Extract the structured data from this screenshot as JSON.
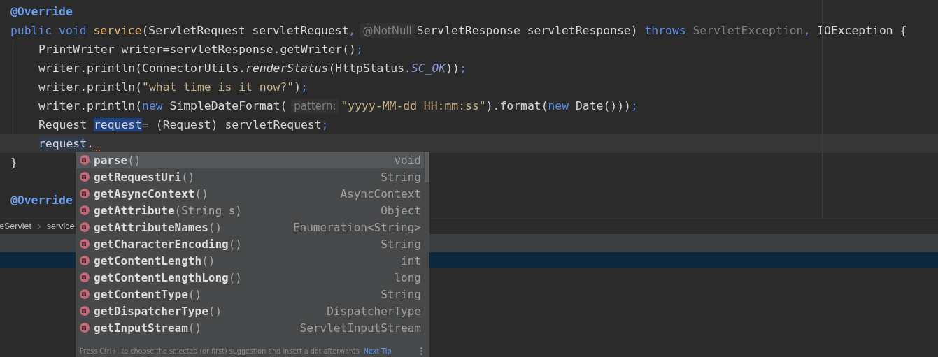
{
  "editor": {
    "lines": [
      {
        "current": false,
        "segments": [
          {
            "kind": "code",
            "tokens": [
              {
                "t": "@Override",
                "kind": "annotation"
              }
            ]
          }
        ]
      },
      {
        "current": false,
        "segments": [
          {
            "kind": "code",
            "tokens": [
              {
                "t": "public void ",
                "kind": "keyword"
              },
              {
                "t": "service",
                "kind": "method"
              },
              {
                "t": "(ServletRequest servletRequest",
                "kind": "plain"
              },
              {
                "t": ",",
                "kind": "punct"
              }
            ]
          },
          {
            "kind": "hint",
            "text": "@NotNull"
          },
          {
            "kind": "code",
            "tokens": [
              {
                "t": "ServletResponse servletResponse) ",
                "kind": "plain"
              },
              {
                "t": "throws ",
                "kind": "keyword"
              },
              {
                "t": "ServletException",
                "kind": "muted"
              },
              {
                "t": ", ",
                "kind": "punct"
              },
              {
                "t": "IOException {",
                "kind": "plain"
              }
            ]
          }
        ],
        "children": [
          {
            "current": false,
            "segments": [
              {
                "kind": "code",
                "tokens": [
                  {
                    "t": "PrintWriter writer=servletResponse.getWriter()",
                    "kind": "plain"
                  },
                  {
                    "t": ";",
                    "kind": "punct"
                  }
                ]
              }
            ]
          },
          {
            "current": false,
            "segments": [
              {
                "kind": "code",
                "tokens": [
                  {
                    "t": "writer.println(ConnectorUtils.",
                    "kind": "plain"
                  },
                  {
                    "t": "renderStatus",
                    "kind": "italic"
                  },
                  {
                    "t": "(HttpStatus.",
                    "kind": "plain"
                  },
                  {
                    "t": "SC_OK",
                    "kind": "const"
                  },
                  {
                    "t": "))",
                    "kind": "plain"
                  },
                  {
                    "t": ";",
                    "kind": "punct"
                  }
                ]
              }
            ]
          },
          {
            "current": false,
            "segments": [
              {
                "kind": "code",
                "tokens": [
                  {
                    "t": "writer.println(",
                    "kind": "plain"
                  },
                  {
                    "t": "\"what time is it now?\"",
                    "kind": "string"
                  },
                  {
                    "t": ")",
                    "kind": "plain"
                  },
                  {
                    "t": ";",
                    "kind": "punct"
                  }
                ]
              }
            ]
          },
          {
            "current": false,
            "segments": [
              {
                "kind": "code",
                "tokens": [
                  {
                    "t": "writer.println(",
                    "kind": "plain"
                  },
                  {
                    "t": "new ",
                    "kind": "keyword"
                  },
                  {
                    "t": "SimpleDateFormat(",
                    "kind": "plain"
                  }
                ]
              },
              {
                "kind": "hint",
                "text": "pattern:"
              },
              {
                "kind": "code",
                "tokens": [
                  {
                    "t": "\"yyyy-MM-dd HH:mm:ss\"",
                    "kind": "string"
                  },
                  {
                    "t": ").format(",
                    "kind": "plain"
                  },
                  {
                    "t": "new ",
                    "kind": "keyword"
                  },
                  {
                    "t": "Date()))",
                    "kind": "plain"
                  },
                  {
                    "t": ";",
                    "kind": "punct"
                  }
                ]
              }
            ]
          },
          {
            "current": false,
            "segments": [
              {
                "kind": "code",
                "tokens": [
                  {
                    "t": "Request ",
                    "kind": "plain"
                  },
                  {
                    "t": "request",
                    "kind": "selected"
                  },
                  {
                    "t": "= (Request) servletRequest",
                    "kind": "plain"
                  },
                  {
                    "t": ";",
                    "kind": "punct"
                  }
                ]
              }
            ]
          },
          {
            "current": true,
            "segments": [
              {
                "kind": "code",
                "tokens": [
                  {
                    "t": "request",
                    "kind": "usage"
                  },
                  {
                    "t": ".",
                    "kind": "plain"
                  }
                ]
              },
              {
                "kind": "squiggle"
              }
            ]
          }
        ]
      },
      {
        "current": false,
        "segments": [
          {
            "kind": "code",
            "tokens": [
              {
                "t": "}",
                "kind": "plain"
              }
            ]
          }
        ]
      },
      {
        "current": false
      },
      {
        "current": false,
        "segments": [
          {
            "kind": "code",
            "tokens": [
              {
                "t": "@Override",
                "kind": "annotation"
              }
            ]
          }
        ]
      }
    ]
  },
  "breadcrumbs": [
    "eServlet",
    "service"
  ],
  "completion": {
    "items": [
      {
        "name": "parse",
        "params": "()",
        "type": "void",
        "selected": true
      },
      {
        "name": "getRequestUri",
        "params": "()",
        "type": "String",
        "selected": false
      },
      {
        "name": "getAsyncContext",
        "params": "()",
        "type": "AsyncContext",
        "selected": false
      },
      {
        "name": "getAttribute",
        "params": "(String s)",
        "type": "Object",
        "selected": false
      },
      {
        "name": "getAttributeNames",
        "params": "()",
        "type": "Enumeration<String>",
        "selected": false
      },
      {
        "name": "getCharacterEncoding",
        "params": "()",
        "type": "String",
        "selected": false
      },
      {
        "name": "getContentLength",
        "params": "()",
        "type": "int",
        "selected": false
      },
      {
        "name": "getContentLengthLong",
        "params": "()",
        "type": "long",
        "selected": false
      },
      {
        "name": "getContentType",
        "params": "()",
        "type": "String",
        "selected": false
      },
      {
        "name": "getDispatcherType",
        "params": "()",
        "type": "DispatcherType",
        "selected": false
      },
      {
        "name": "getInputStream",
        "params": "()",
        "type": "ServletInputStream",
        "selected": false
      }
    ],
    "footer": "Press Ctrl+. to choose the selected (or first) suggestion and insert a dot afterwards",
    "footer_link": "Next Tip"
  }
}
